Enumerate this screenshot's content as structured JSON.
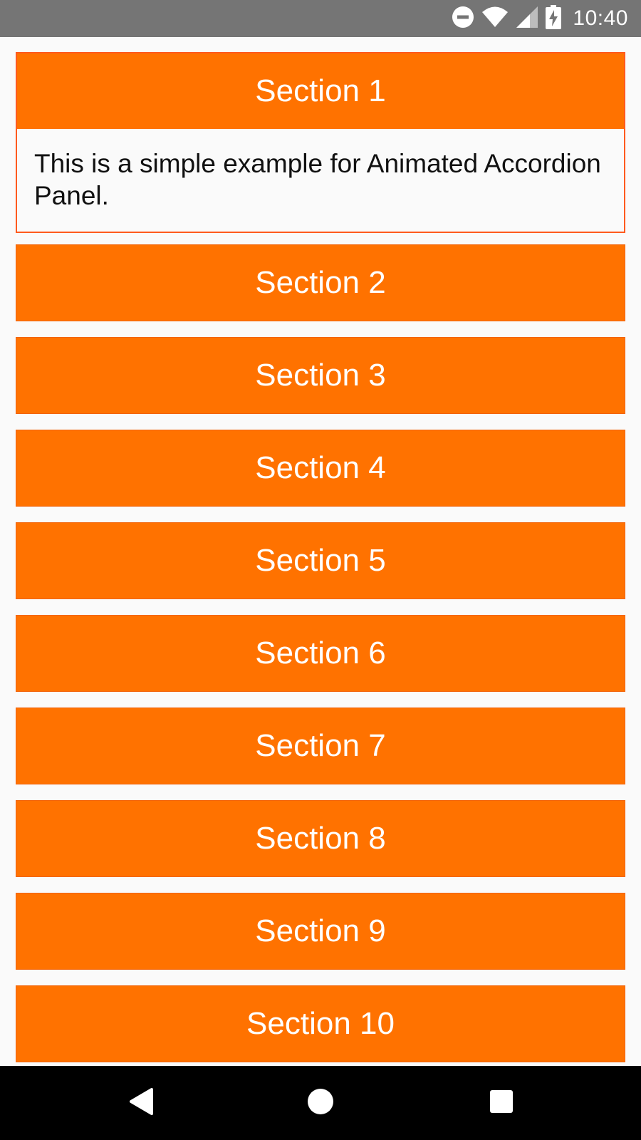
{
  "status_bar": {
    "time": "10:40",
    "icons": [
      "do-not-disturb-icon",
      "wifi-icon",
      "cellular-signal-icon",
      "battery-charging-icon"
    ]
  },
  "colors": {
    "header_bg": "#FF7200",
    "header_text": "#FFFFFF",
    "open_border": "#FF5A1E",
    "status_bar_bg": "#757575",
    "nav_bar_bg": "#000000"
  },
  "accordion": {
    "sections": [
      {
        "title": "Section 1",
        "expanded": true,
        "body": "This is a simple example for Animated Accordion Panel."
      },
      {
        "title": "Section 2",
        "expanded": false
      },
      {
        "title": "Section 3",
        "expanded": false
      },
      {
        "title": "Section 4",
        "expanded": false
      },
      {
        "title": "Section 5",
        "expanded": false
      },
      {
        "title": "Section 6",
        "expanded": false
      },
      {
        "title": "Section 7",
        "expanded": false
      },
      {
        "title": "Section 8",
        "expanded": false
      },
      {
        "title": "Section 9",
        "expanded": false
      },
      {
        "title": "Section 10",
        "expanded": false
      }
    ]
  },
  "nav_bar": {
    "buttons": [
      "back-icon",
      "home-icon",
      "recents-icon"
    ]
  }
}
